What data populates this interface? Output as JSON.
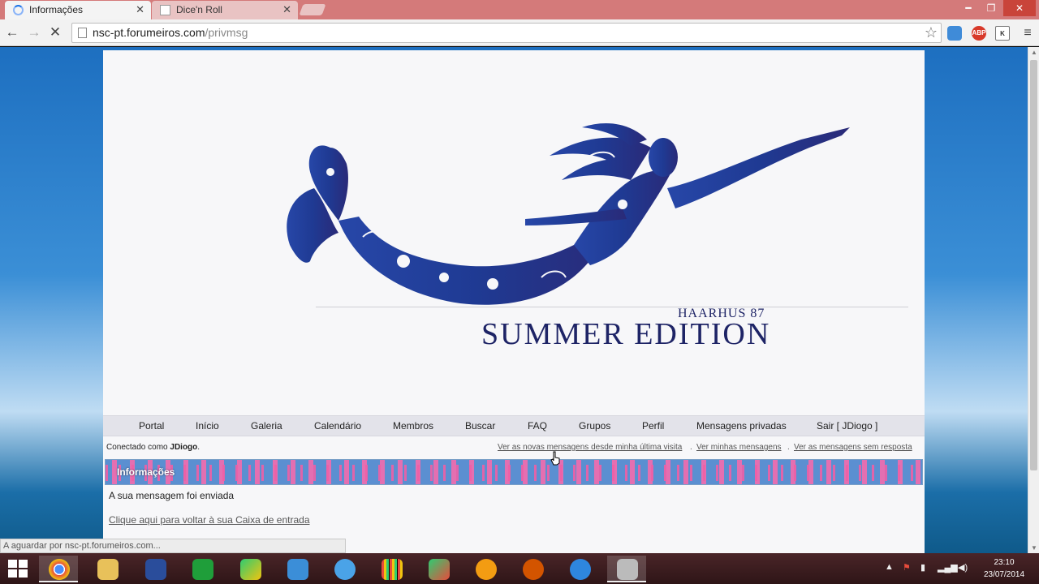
{
  "browser": {
    "tabs": [
      {
        "title": "Informações",
        "state": "loading"
      },
      {
        "title": "Dice'n Roll",
        "state": "inactive"
      }
    ],
    "close_glyph": "✕",
    "url_host": "nsc-pt.forumeiros.com",
    "url_path": "/privmsg",
    "status_text": "A aguardar por nsc-pt.forumeiros.com...",
    "extensions": [
      {
        "name": "icloud-icon",
        "label": ""
      },
      {
        "name": "adblock-plus-icon",
        "label": "ABP"
      },
      {
        "name": "k-extension-icon",
        "label": "K"
      }
    ]
  },
  "banner": {
    "sub_title": "HAARHUS 87",
    "main_title": "SUMMER EDITION"
  },
  "nav": {
    "items": [
      "Portal",
      "Início",
      "Galeria",
      "Calendário",
      "Membros",
      "Buscar",
      "FAQ",
      "Grupos",
      "Perfil",
      "Mensagens privadas",
      "Sair [ JDiogo ]"
    ]
  },
  "session": {
    "prefix": "Conectado como",
    "user": "JDiogo",
    "suffix": ".",
    "quick_links": [
      "Ver as novas mensagens desde minha última visita",
      "Ver minhas mensagens",
      "Ver as mensagens sem resposta"
    ],
    "separator": "."
  },
  "info": {
    "header": "Informações",
    "message": "A sua mensagem foi enviada",
    "back_link": "Clique aqui para voltar à sua Caixa de entrada"
  },
  "taskbar": {
    "time": "23:10",
    "date": "23/07/2014",
    "apps": [
      "chrome-icon",
      "file-explorer-icon",
      "help-icon",
      "store-icon",
      "app-icon",
      "dropbox-icon",
      "itunes-icon",
      "equalizer-icon",
      "paint-icon",
      "media-icon",
      "glove-icon",
      "lightning-icon",
      "camera-icon"
    ]
  },
  "colors": {
    "tabstrip": "#d47a7a",
    "title_text": "#1e2466",
    "mermaid": "#1f3a93"
  }
}
